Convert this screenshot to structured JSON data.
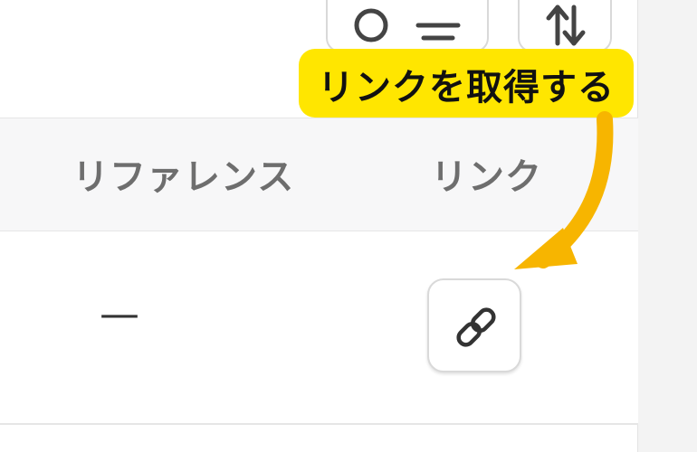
{
  "table": {
    "columns": {
      "reference": "リファレンス",
      "link": "リンク"
    },
    "rows": [
      {
        "reference": "—",
        "link_icon": "link-icon"
      }
    ]
  },
  "toolbar": {
    "icons": [
      "search-icon",
      "filter-icon",
      "sort-icon"
    ]
  },
  "annotation": {
    "text": "リンクを取得する",
    "color": "#ffe600",
    "arrow_color": "#f7b500"
  }
}
